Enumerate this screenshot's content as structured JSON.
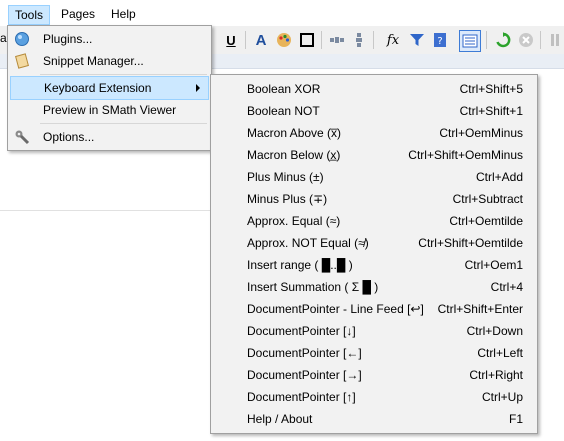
{
  "menubar": {
    "items": [
      "Tools",
      "Pages",
      "Help"
    ]
  },
  "toolbar": {
    "left_cut_text": "al",
    "icons": [
      "underline-icon",
      "font-color-icon",
      "palette-icon",
      "border-icon",
      "align-horizontal-icon",
      "align-vertical-icon",
      "function-icon",
      "filter-icon",
      "help-book-icon",
      "grid-toggle-icon",
      "refresh-icon",
      "stop-icon",
      "pause-icon"
    ]
  },
  "tools_menu": {
    "items": [
      {
        "label": "Plugins...",
        "icon": "plugins-icon"
      },
      {
        "label": "Snippet Manager...",
        "icon": "snippet-icon"
      },
      {
        "label": "Keyboard Extension",
        "icon": "",
        "submenu": true
      },
      {
        "label": "Preview in SMath Viewer",
        "icon": ""
      },
      {
        "label": "Options...",
        "icon": "options-wrench-icon"
      }
    ]
  },
  "keyboard_extension": {
    "items": [
      {
        "label": "Boolean XOR",
        "shortcut": "Ctrl+Shift+5"
      },
      {
        "label": "Boolean NOT",
        "shortcut": "Ctrl+Shift+1"
      },
      {
        "label": "Macron Above (x̅)",
        "shortcut": "Ctrl+OemMinus"
      },
      {
        "label": "Macron Below (x̲)",
        "shortcut": "Ctrl+Shift+OemMinus"
      },
      {
        "label": "Plus Minus (±)",
        "shortcut": "Ctrl+Add"
      },
      {
        "label": "Minus Plus (∓)",
        "shortcut": "Ctrl+Subtract"
      },
      {
        "label": "Approx. Equal (≈)",
        "shortcut": "Ctrl+Oemtilde"
      },
      {
        "label": "Approx. NOT Equal (≉)",
        "shortcut": "Ctrl+Shift+Oemtilde"
      },
      {
        "label": "Insert range ( █..█ )",
        "shortcut": "Ctrl+Oem1"
      },
      {
        "label": "Insert Summation ( Σ █ )",
        "shortcut": "Ctrl+4"
      },
      {
        "label": "DocumentPointer - Line Feed [↩]",
        "shortcut": "Ctrl+Shift+Enter"
      },
      {
        "label": "DocumentPointer [↓]",
        "shortcut": "Ctrl+Down"
      },
      {
        "label": "DocumentPointer [←]",
        "shortcut": "Ctrl+Left"
      },
      {
        "label": "DocumentPointer [→]",
        "shortcut": "Ctrl+Right"
      },
      {
        "label": "DocumentPointer [↑]",
        "shortcut": "Ctrl+Up"
      },
      {
        "label": "Help / About",
        "shortcut": "F1"
      }
    ]
  },
  "colors": {
    "highlight": "#cce8ff",
    "highlight_border": "#99d1ff",
    "menu_bg": "#f2f2f2",
    "toolbar_bg": "#f0f0f0"
  }
}
